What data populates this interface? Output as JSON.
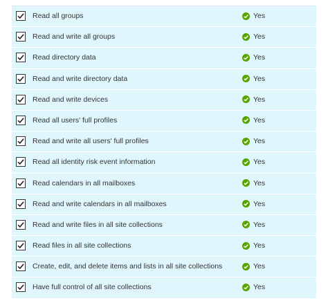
{
  "colors": {
    "row_background": "#dff6fd",
    "check_green": "#57a300",
    "text": "#333333"
  },
  "icons": {
    "checkbox": "checkmark-icon",
    "status": "check-circle-icon"
  },
  "permissions": [
    {
      "label": "Read all groups",
      "checked": true,
      "status": "Yes"
    },
    {
      "label": "Read and write all groups",
      "checked": true,
      "status": "Yes"
    },
    {
      "label": "Read directory data",
      "checked": true,
      "status": "Yes"
    },
    {
      "label": "Read and write directory data",
      "checked": true,
      "status": "Yes"
    },
    {
      "label": "Read and write devices",
      "checked": true,
      "status": "Yes"
    },
    {
      "label": "Read all users' full profiles",
      "checked": true,
      "status": "Yes"
    },
    {
      "label": "Read and write all users' full profiles",
      "checked": true,
      "status": "Yes"
    },
    {
      "label": "Read all identity risk event information",
      "checked": true,
      "status": "Yes"
    },
    {
      "label": "Read calendars in all mailboxes",
      "checked": true,
      "status": "Yes"
    },
    {
      "label": "Read and write calendars in all mailboxes",
      "checked": true,
      "status": "Yes"
    },
    {
      "label": "Read and write files in all site collections",
      "checked": true,
      "status": "Yes"
    },
    {
      "label": "Read files in all site collections",
      "checked": true,
      "status": "Yes"
    },
    {
      "label": "Create, edit, and delete items and lists in all site collections",
      "checked": true,
      "status": "Yes"
    },
    {
      "label": "Have full control of all site collections",
      "checked": true,
      "status": "Yes"
    }
  ]
}
